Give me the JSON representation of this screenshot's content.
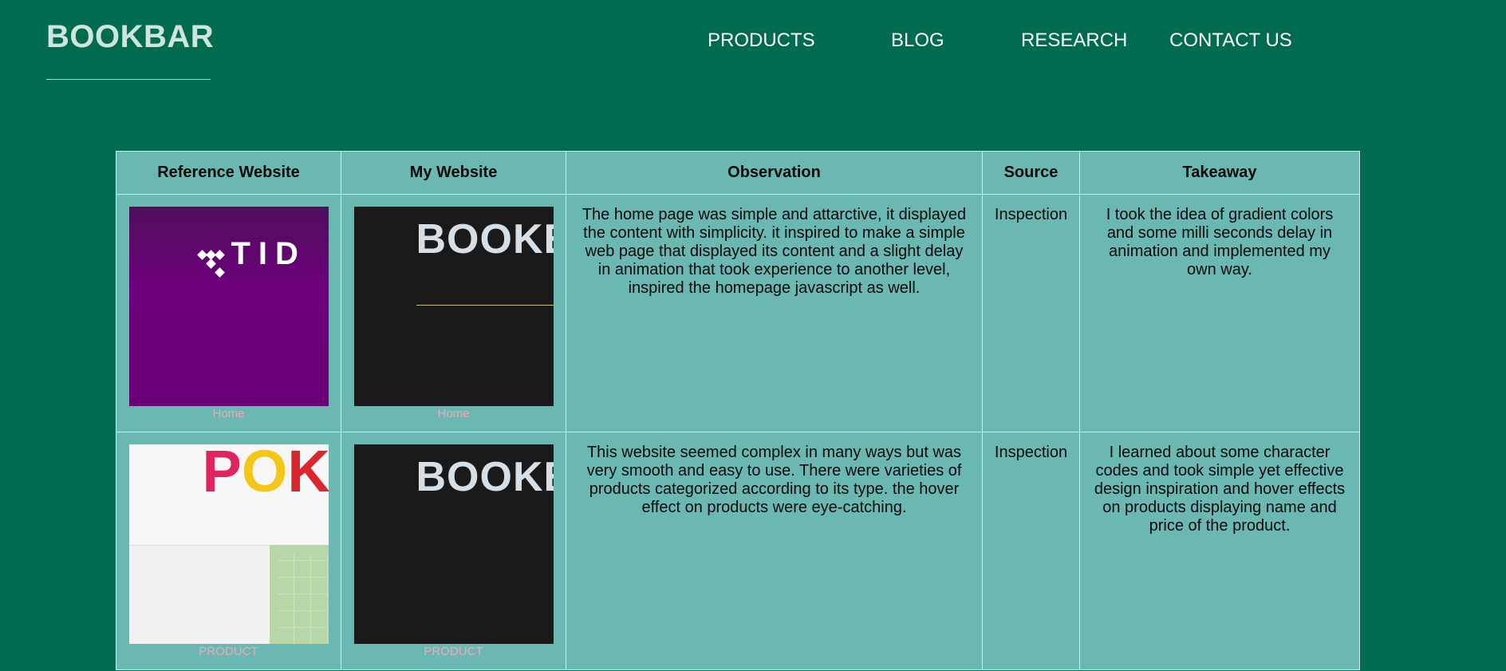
{
  "brand": {
    "name": "BOOKBAR"
  },
  "nav": {
    "items": [
      "PRODUCTS",
      "BLOG",
      "RESEARCH",
      "CONTACT US"
    ]
  },
  "table": {
    "headers": [
      "Reference Website",
      "My Website",
      "Observation",
      "Source",
      "Takeaway"
    ],
    "rows": [
      {
        "ref_thumb_text": "TID",
        "ref_caption": "Home",
        "my_thumb_text": "BOOKE",
        "my_caption": "Home",
        "observation": "The home page was simple and attarctive, it displayed the content with simplicity. it inspired to make a simple web page that displayed its content and a slight delay in animation that took experience to another level, inspired the homepage javascript as well.",
        "source": "Inspection",
        "takeaway": "I took the idea of gradient colors and some milli seconds delay in animation and implemented my own way."
      },
      {
        "ref_thumb_text": "POK",
        "ref_caption": "PRODUCT",
        "my_thumb_text": "BOOKE",
        "my_caption": "PRODUCT",
        "observation": "This website seemed complex in many ways but was very smooth and easy to use. There were varieties of products categorized according to its type. the hover effect on products were eye-catching.",
        "source": "Inspection",
        "takeaway": "I learned about some character codes and took simple yet effective design inspiration and hover effects on products displaying name and price of the product."
      }
    ]
  },
  "colors": {
    "background": "#006b4e",
    "table_bg": "#6bb8b2",
    "logo_underline": "#d8c48a",
    "caption": "#f0a9b9"
  }
}
